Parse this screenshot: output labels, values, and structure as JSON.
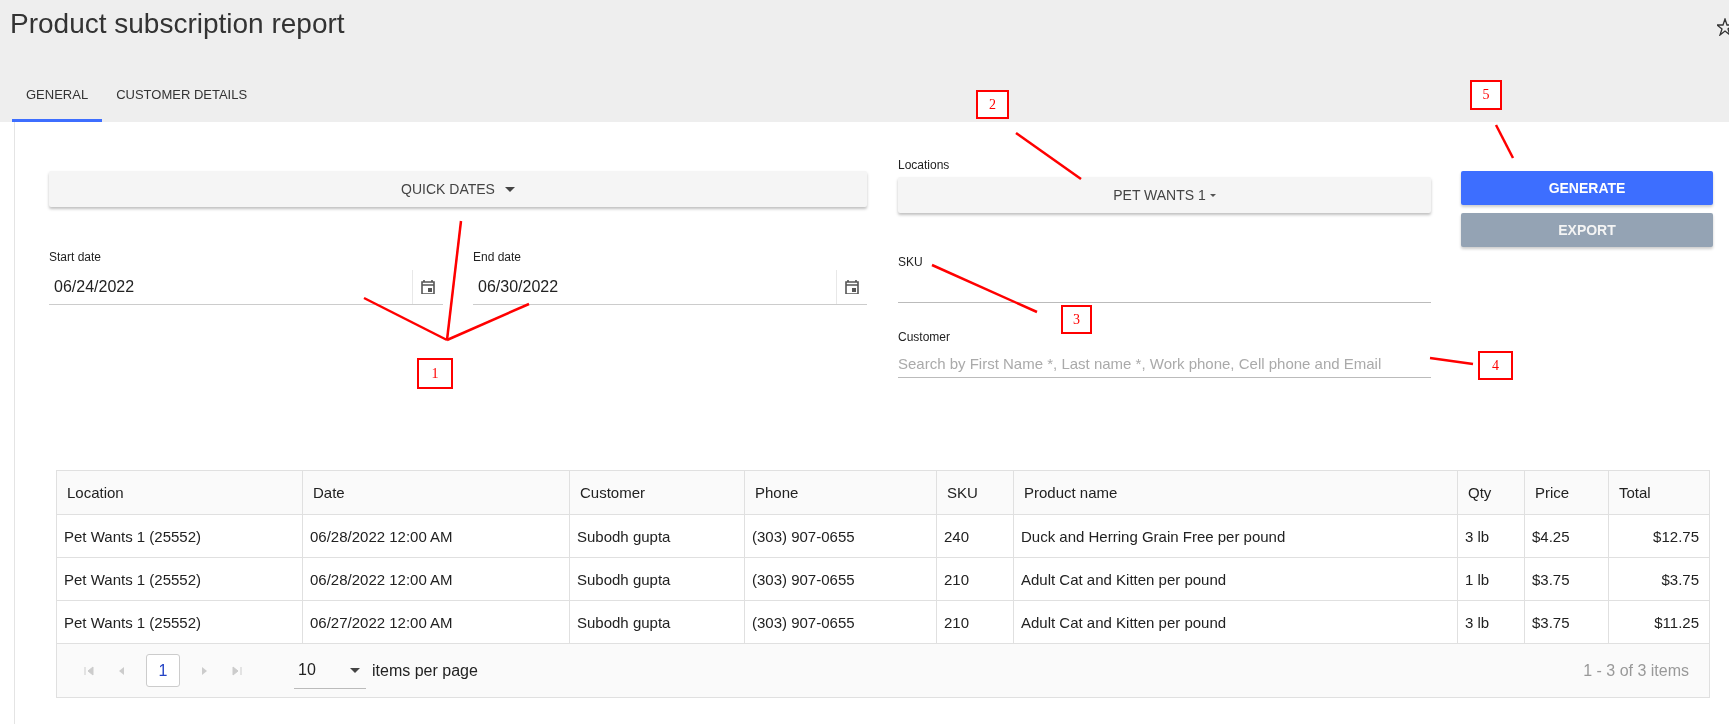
{
  "title": "Product subscription report",
  "tabs": [
    {
      "label": "GENERAL",
      "selected": true
    },
    {
      "label": "CUSTOMER DETAILS",
      "selected": false
    }
  ],
  "quick_dates": {
    "label": "QUICK DATES"
  },
  "start_date": {
    "label": "Start date",
    "value": "06/24/2022"
  },
  "end_date": {
    "label": "End date",
    "value": "06/30/2022"
  },
  "locations": {
    "label": "Locations",
    "value": "PET WANTS 1"
  },
  "sku": {
    "label": "SKU"
  },
  "customer": {
    "label": "Customer",
    "placeholder": "Search by First Name *, Last name *, Work phone, Cell phone and Email"
  },
  "buttons": [
    {
      "label": "GENERATE",
      "disabled": false
    },
    {
      "label": "EXPORT",
      "disabled": true
    }
  ],
  "table": {
    "columns": [
      "Location",
      "Date",
      "Customer",
      "Phone",
      "SKU",
      "Product name",
      "Qty",
      "Price",
      "Total"
    ],
    "rows": [
      [
        "Pet Wants 1 (25552)",
        "06/28/2022 12:00 AM",
        "Subodh gupta",
        "(303) 907-0655",
        "240",
        "Duck and Herring Grain Free per pound",
        "3 lb",
        "$4.25",
        "$12.75"
      ],
      [
        "Pet Wants 1 (25552)",
        "06/28/2022 12:00 AM",
        "Subodh gupta",
        "(303) 907-0655",
        "210",
        "Adult Cat and Kitten per pound",
        "1 lb",
        "$3.75",
        "$3.75"
      ],
      [
        "Pet Wants 1 (25552)",
        "06/27/2022 12:00 AM",
        "Subodh gupta",
        "(303) 907-0655",
        "210",
        "Adult Cat and Kitten per pound",
        "3 lb",
        "$3.75",
        "$11.25"
      ]
    ]
  },
  "pager": {
    "pages": [
      {
        "label": "1",
        "selected": true
      }
    ],
    "page_size": "10",
    "page_size_label": "items per page",
    "summary": "1 - 3 of 3 items"
  },
  "annotations": [
    {
      "label": "1"
    },
    {
      "label": "2"
    },
    {
      "label": "3"
    },
    {
      "label": "4"
    },
    {
      "label": "5"
    }
  ]
}
